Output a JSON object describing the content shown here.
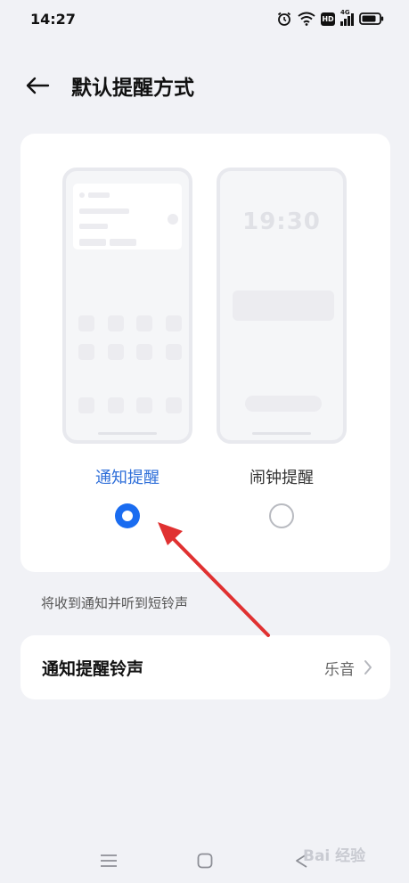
{
  "status_bar": {
    "time": "14:27",
    "network_badge": "HD",
    "signal_label": "4G"
  },
  "header": {
    "title": "默认提醒方式"
  },
  "modes": {
    "notification": {
      "label": "通知提醒",
      "selected": true
    },
    "alarm": {
      "label": "闹钟提醒",
      "selected": false,
      "preview_clock": "19:30"
    }
  },
  "description": "将收到通知并听到短铃声",
  "ringtone": {
    "title": "通知提醒铃声",
    "value": "乐音"
  },
  "watermark": "Bai 经验",
  "colors": {
    "accent": "#1a6cf0",
    "label_selected": "#2f6fd9",
    "annotation_arrow": "#e03131",
    "background": "#f1f2f6"
  }
}
